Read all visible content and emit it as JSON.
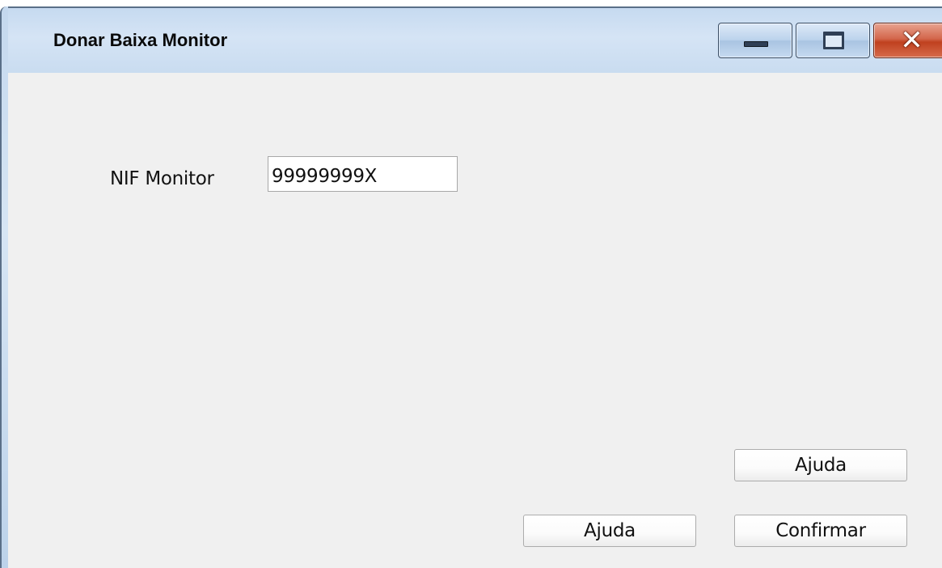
{
  "window": {
    "title": "Donar Baixa Monitor",
    "controls": {
      "minimize_icon": "minimize-icon",
      "maximize_icon": "maximize-icon",
      "close_icon": "close-icon",
      "close_glyph": "✕"
    }
  },
  "form": {
    "nif_label": "NIF Monitor",
    "nif_value": "99999999X"
  },
  "buttons": {
    "help_top_label": "Ajuda",
    "help_bottom_label": "Ajuda",
    "confirm_label": "Confirmar"
  },
  "colors": {
    "titlebar": "#c9dcf0",
    "content_bg": "#f0f0f0",
    "close_button": "#c0411f"
  }
}
